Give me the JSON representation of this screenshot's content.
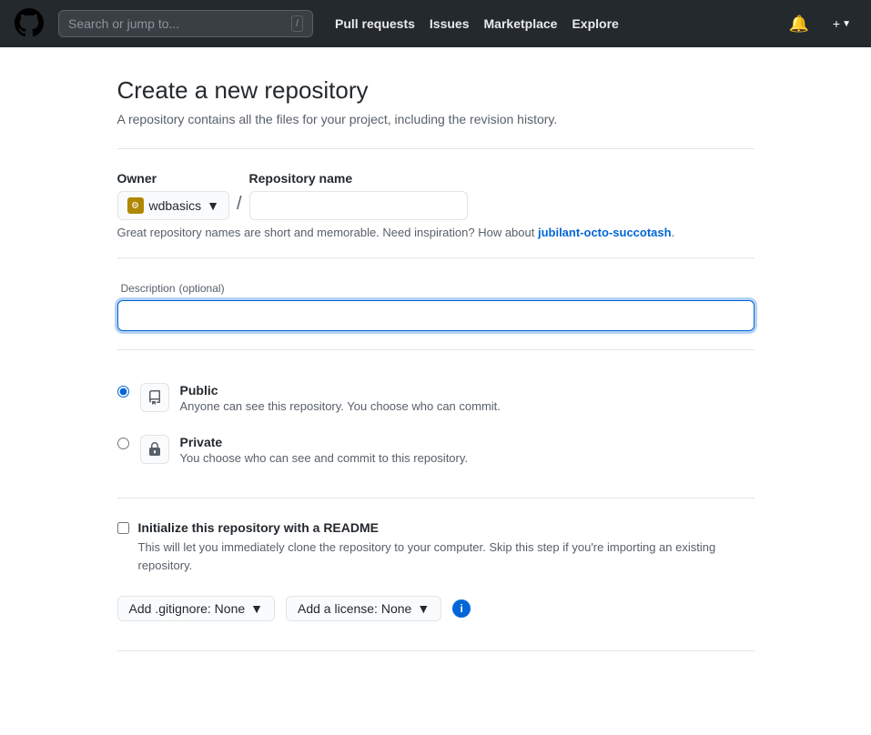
{
  "navbar": {
    "search_placeholder": "Search or jump to...",
    "slash_key": "/",
    "links": [
      {
        "label": "Pull requests",
        "name": "pull-requests-link"
      },
      {
        "label": "Issues",
        "name": "issues-link"
      },
      {
        "label": "Marketplace",
        "name": "marketplace-link"
      },
      {
        "label": "Explore",
        "name": "explore-link"
      }
    ],
    "plus_label": "+",
    "bell_icon": "🔔"
  },
  "page": {
    "title": "Create a new repository",
    "subtitle": "A repository contains all the files for your project, including the revision history."
  },
  "form": {
    "owner_label": "Owner",
    "owner_name": "wdbasics",
    "repo_name_label": "Repository name",
    "repo_name_placeholder": "",
    "slash": "/",
    "inspiration_text": "Great repository names are short and memorable. Need inspiration? How about ",
    "inspiration_link": "jubilant-octo-succotash",
    "inspiration_end": ".",
    "desc_label": "Description",
    "desc_optional": "(optional)",
    "desc_placeholder": "",
    "visibility": {
      "public_label": "Public",
      "public_desc": "Anyone can see this repository. You choose who can commit.",
      "private_label": "Private",
      "private_desc": "You choose who can see and commit to this repository."
    },
    "init": {
      "label": "Initialize this repository with a README",
      "desc": "This will let you immediately clone the repository to your computer. Skip this step if you're importing an existing repository."
    },
    "gitignore_btn": "Add .gitignore: None",
    "license_btn": "Add a license: None"
  }
}
